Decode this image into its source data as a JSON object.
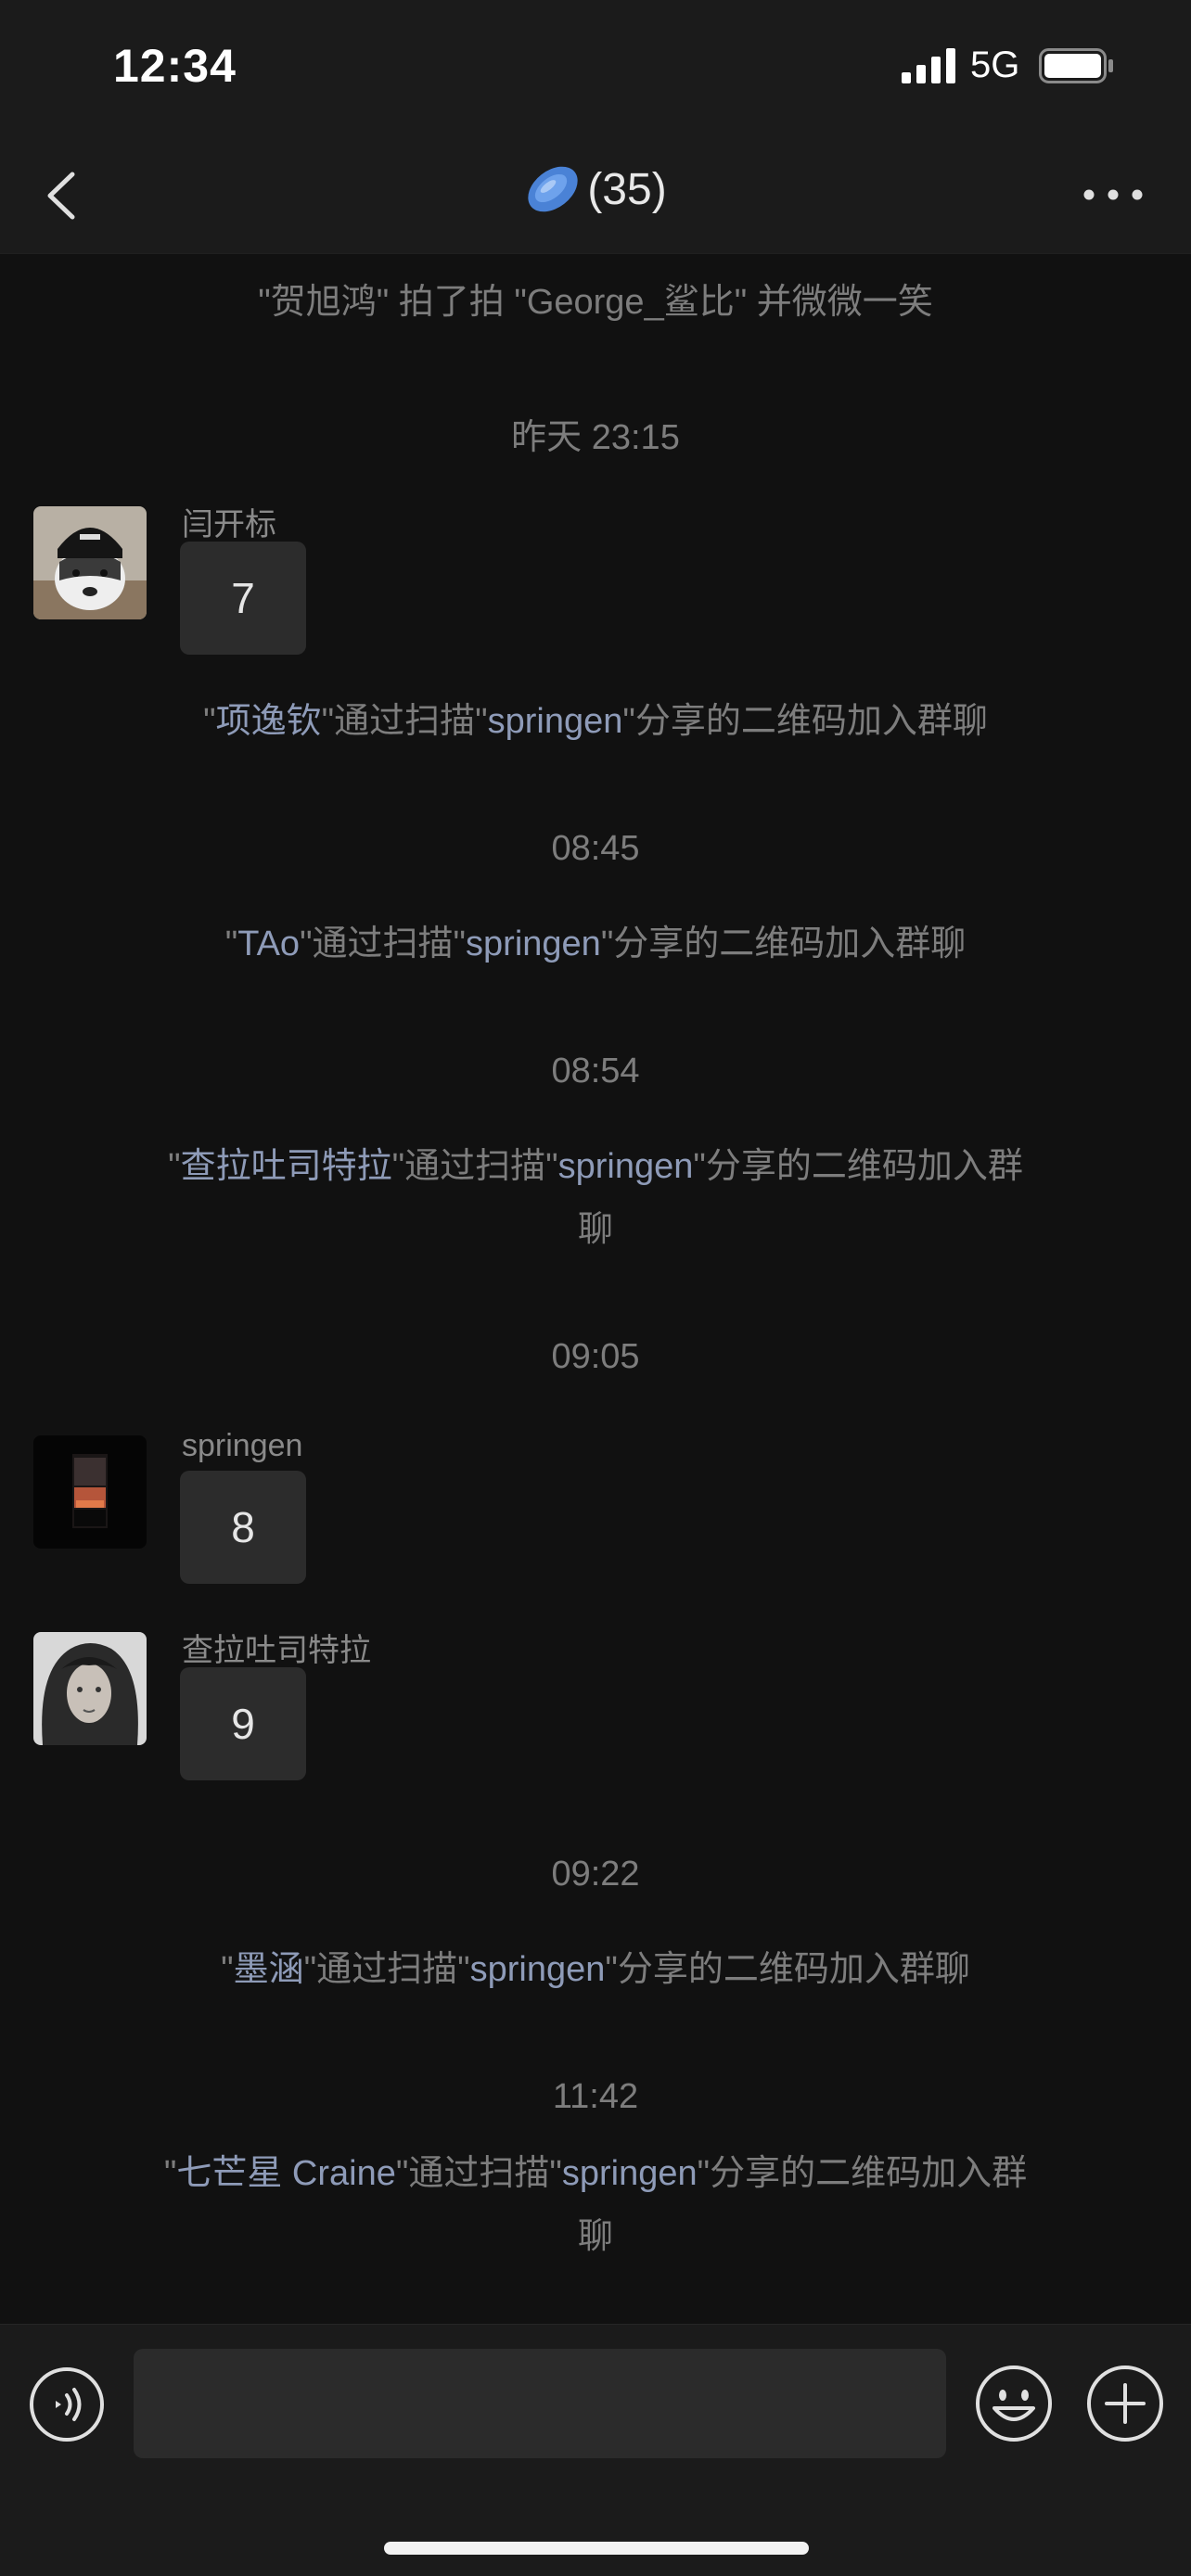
{
  "status_bar": {
    "time": "12:34",
    "network": "5G"
  },
  "nav": {
    "title": "(35)",
    "title_icon": "frisbee-emoji",
    "back_icon": "chevron-left-icon",
    "more_icon": "more-dots-icon"
  },
  "chat": {
    "pat_notice": "\"贺旭鸿\" 拍了拍 \"George_鲨比\" 并微微一笑",
    "timestamps": [
      "昨天 23:15",
      "08:45",
      "08:54",
      "09:05",
      "09:22",
      "11:42"
    ],
    "join_text": "\"通过扫描\"",
    "join_suffix": "\"分享的二维码加入群聊",
    "inviter": "springen",
    "joins": [
      {
        "name": "项逸钦"
      },
      {
        "name": "TAo"
      },
      {
        "name": "查拉吐司特拉",
        "suffix": "\"分享的二维码加入群",
        "tail": "聊"
      },
      {
        "name": "墨涵"
      },
      {
        "name": "七芒星 Craine",
        "suffix": "\"分享的二维码加入群",
        "tail": "聊"
      }
    ],
    "messages": [
      {
        "sender": "闫开标",
        "text": "7"
      },
      {
        "sender": "springen",
        "text": "8"
      },
      {
        "sender": "查拉吐司特拉",
        "text": "9"
      }
    ]
  },
  "input_bar": {
    "voice_icon": "voice-icon",
    "emoji_icon": "emoji-icon",
    "plus_icon": "plus-icon",
    "value": ""
  },
  "colors": {
    "background": "#111111",
    "bar": "#1b1b1b",
    "bubble": "#2c2c2c",
    "system_text": "#7d7d7d",
    "highlight_name": "#8e9bb8"
  }
}
